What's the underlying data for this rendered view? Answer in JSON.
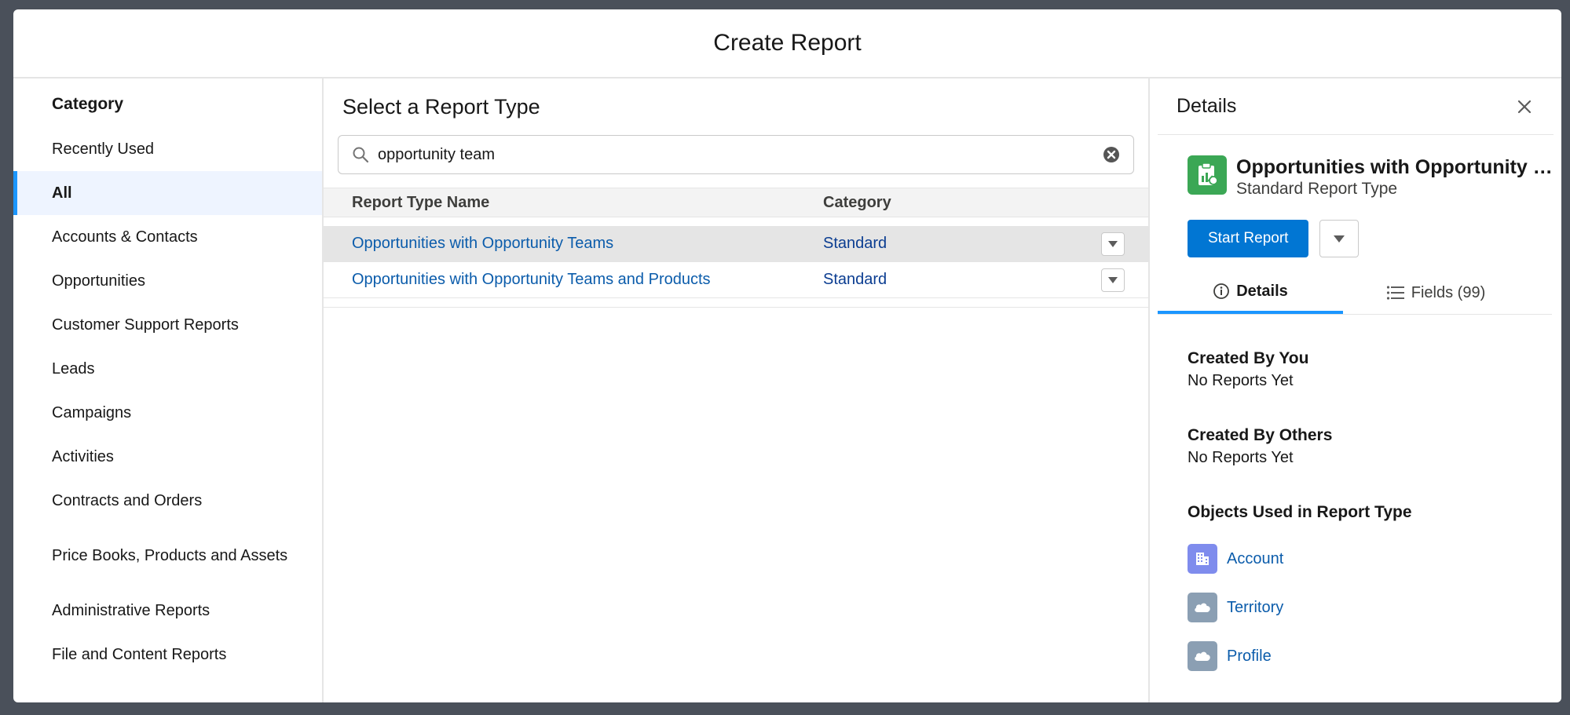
{
  "modal": {
    "title": "Create Report"
  },
  "sidebar": {
    "title": "Category",
    "items": [
      {
        "label": "Recently Used"
      },
      {
        "label": "All"
      },
      {
        "label": "Accounts & Contacts"
      },
      {
        "label": "Opportunities"
      },
      {
        "label": "Customer Support Reports"
      },
      {
        "label": "Leads"
      },
      {
        "label": "Campaigns"
      },
      {
        "label": "Activities"
      },
      {
        "label": "Contracts and Orders"
      },
      {
        "label": "Price Books, Products and Assets"
      },
      {
        "label": "Administrative Reports"
      },
      {
        "label": "File and Content Reports"
      }
    ],
    "active_index": 1
  },
  "main": {
    "title": "Select a Report Type",
    "search": {
      "value": "opportunity team",
      "placeholder": ""
    },
    "table": {
      "headers": {
        "name": "Report Type Name",
        "category": "Category"
      },
      "rows": [
        {
          "name": "Opportunities with Opportunity Teams",
          "category": "Standard"
        },
        {
          "name": "Opportunities with Opportunity Teams and Products",
          "category": "Standard"
        }
      ],
      "selected_index": 0
    }
  },
  "details": {
    "title": "Details",
    "report_type_name": "Opportunities with Opportunity Teams",
    "report_type_sub": "Standard Report Type",
    "start_label": "Start Report",
    "tabs": [
      {
        "label": "Details",
        "icon": "info-icon"
      },
      {
        "label": "Fields (99)",
        "icon": "list-icon"
      }
    ],
    "created_by_you": {
      "title": "Created By You",
      "value": "No Reports Yet"
    },
    "created_by_others": {
      "title": "Created By Others",
      "value": "No Reports Yet"
    },
    "objects_title": "Objects Used in Report Type",
    "objects": [
      {
        "label": "Account",
        "icon": "account-icon",
        "color": "#7f8ced"
      },
      {
        "label": "Territory",
        "icon": "cloud-icon",
        "color": "#8b9fb3"
      },
      {
        "label": "Profile",
        "icon": "cloud-icon",
        "color": "#8b9fb3"
      }
    ]
  },
  "colors": {
    "brand": "#0176d3",
    "accent": "#1b96ff",
    "report_icon": "#3ba755"
  }
}
